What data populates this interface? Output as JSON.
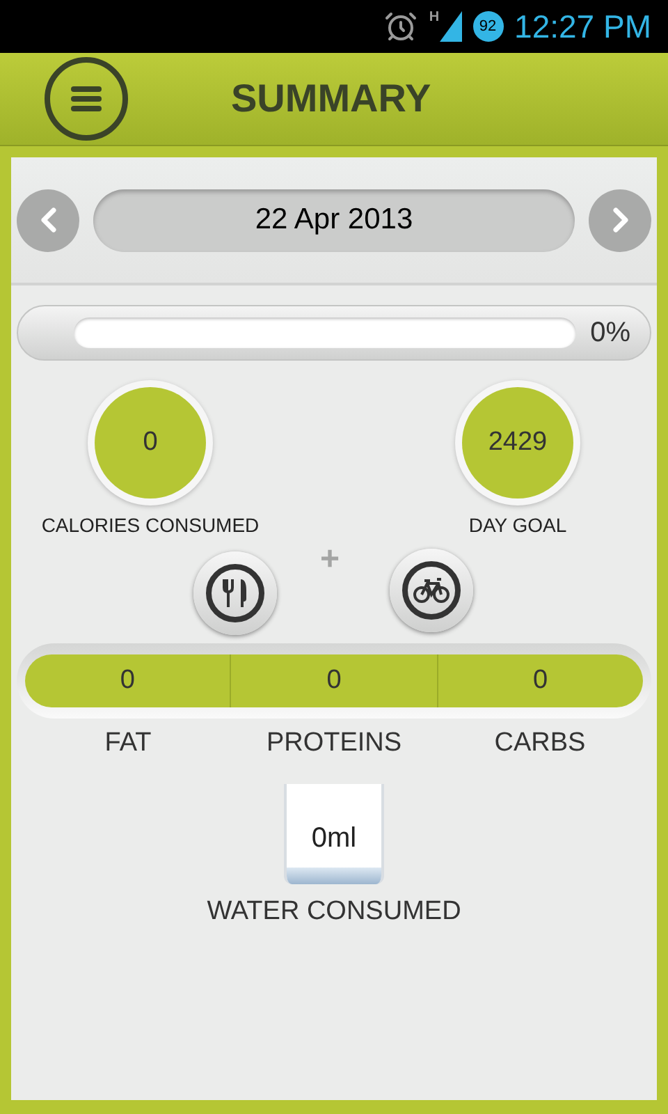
{
  "status_bar": {
    "network": "H",
    "battery": "92",
    "time": "12:27 PM"
  },
  "header": {
    "title": "SUMMARY"
  },
  "date_nav": {
    "date": "22 Apr 2013"
  },
  "progress": {
    "level": 0,
    "reading": "0%"
  },
  "stats": [
    {
      "value": "0",
      "label": "CALORIES CONSUMED"
    },
    {
      "value": "2429",
      "label": "DAY GOAL"
    }
  ],
  "plus": "+",
  "macros": [
    {
      "value": "0",
      "label": "FAT"
    },
    {
      "value": "0",
      "label": "PROTEINS"
    },
    {
      "value": "0",
      "label": "CARBS"
    }
  ],
  "water": {
    "value": "0ml",
    "label": "WATER CONSUMED"
  }
}
